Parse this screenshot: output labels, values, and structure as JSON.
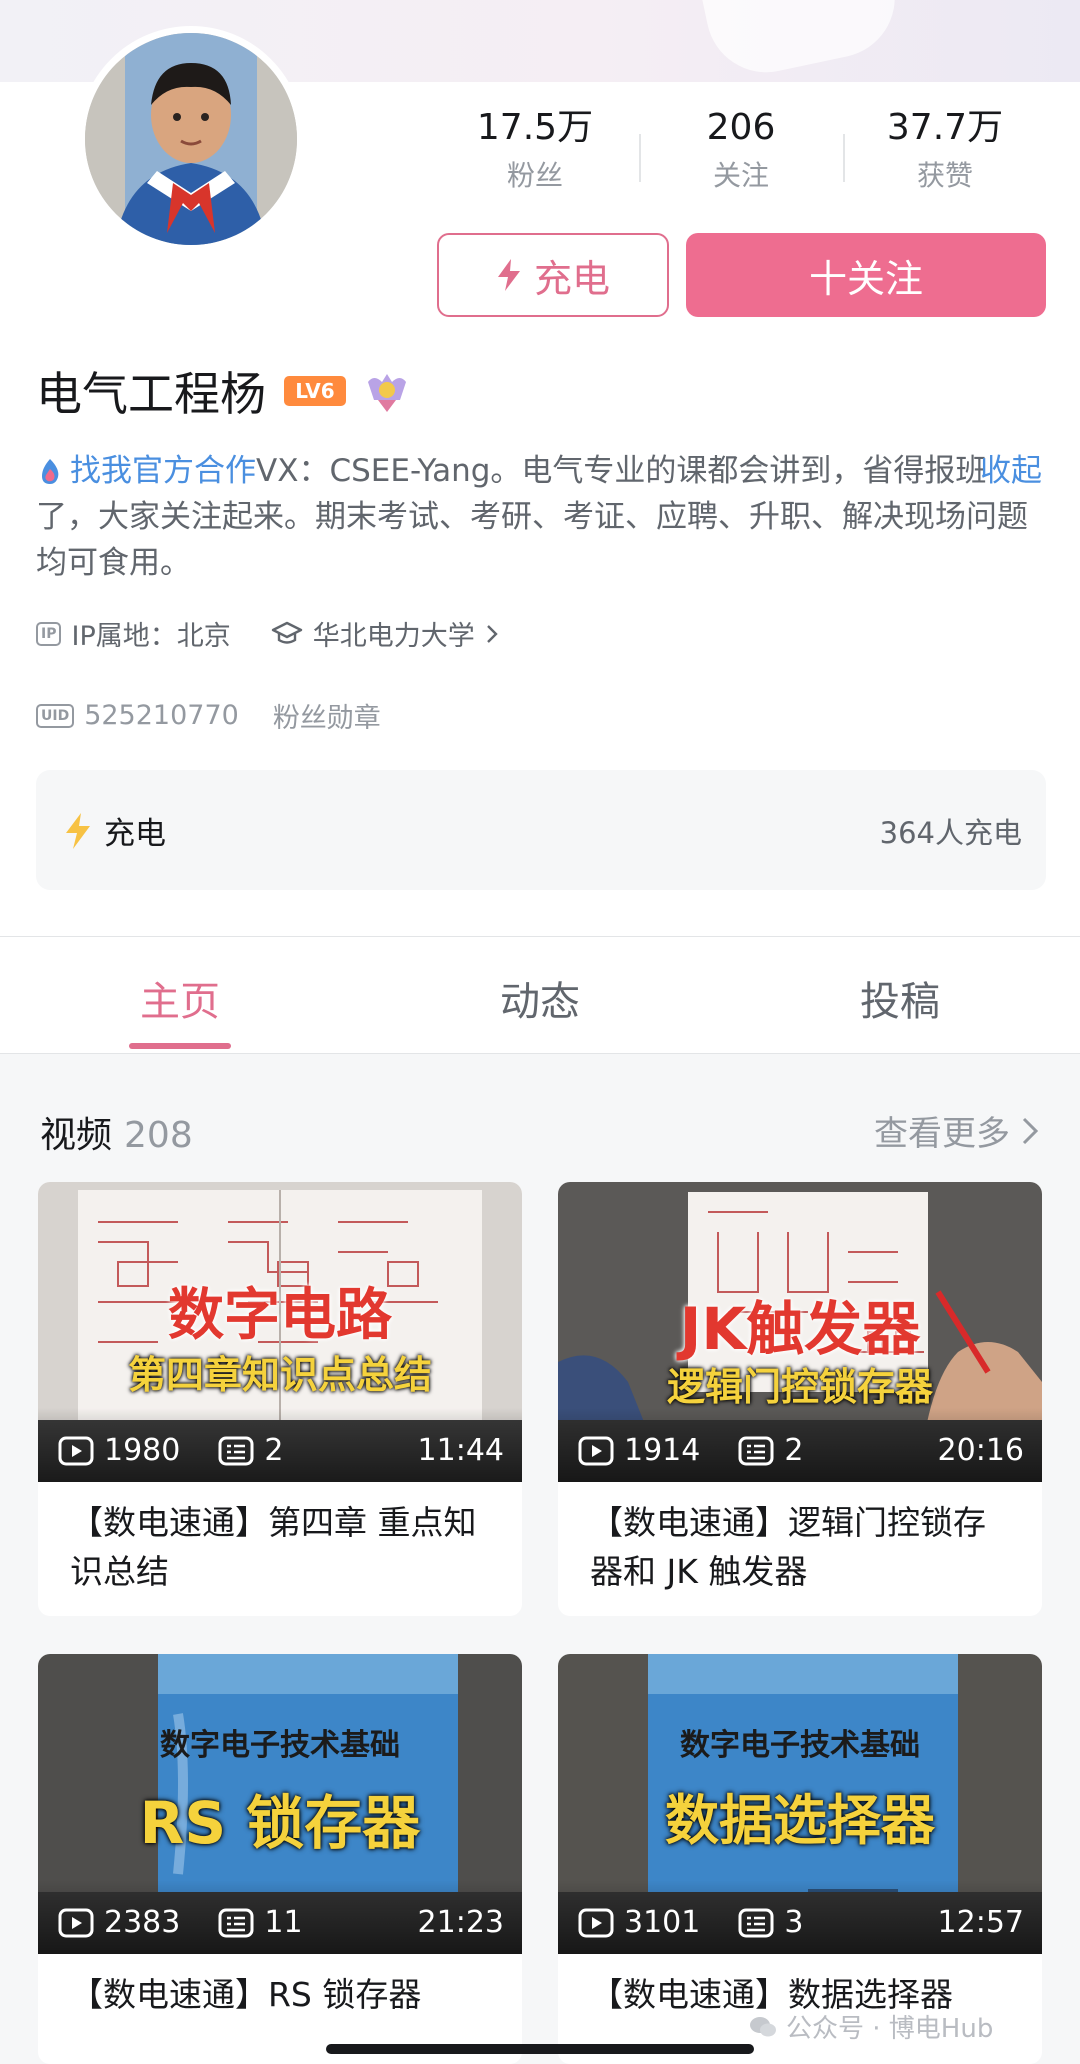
{
  "profile": {
    "name": "电气工程杨",
    "level_badge": "LV6",
    "stats": [
      {
        "value": "17.5万",
        "label": "粉丝"
      },
      {
        "value": "206",
        "label": "关注"
      },
      {
        "value": "37.7万",
        "label": "获赞"
      }
    ],
    "charge_button": "充电",
    "follow_button": "十关注",
    "bio_link": "找我官方合作",
    "bio_text": "VX：CSEE-Yang。电气专业的课都会讲到，省得报班了，大家关注起来。期末考试、考研、考证、应聘、升职、解决现场问题均可食用。",
    "bio_toggle": "收起",
    "ip_tag": "IP",
    "ip_location": "IP属地：北京",
    "school": "华北电力大学",
    "uid_tag": "UID",
    "uid": "525210770",
    "fan_badge": "粉丝勋章"
  },
  "charge_card": {
    "label": "充电",
    "count_text": "364人充电"
  },
  "tabs": [
    "主页",
    "动态",
    "投稿"
  ],
  "videos_section": {
    "title": "视频",
    "count": "208",
    "more": "查看更多"
  },
  "videos": [
    {
      "thumb_main": "数字电路",
      "thumb_sub": "第四章知识点总结",
      "views": "1980",
      "danmaku": "2",
      "duration": "11:44",
      "title": "【数电速通】第四章 重点知识总结"
    },
    {
      "thumb_main": "JK触发器",
      "thumb_sub": "逻辑门控锁存器",
      "views": "1914",
      "danmaku": "2",
      "duration": "20:16",
      "title": "【数电速通】逻辑门控锁存器和 JK 触发器"
    },
    {
      "thumb_book": "数字电子技术基础",
      "thumb_main": "RS  锁存器",
      "views": "2383",
      "danmaku": "11",
      "duration": "21:23",
      "title": "【数电速通】RS 锁存器"
    },
    {
      "thumb_book": "数字电子技术基础",
      "thumb_main": "数据选择器",
      "views": "3101",
      "danmaku": "3",
      "duration": "12:57",
      "title": "【数电速通】数据选择器"
    }
  ],
  "watermark": "公众号 · 博电Hub",
  "colors": {
    "accent": "#ee6d90",
    "link": "#4a8fe0",
    "level": "#ff8a3d"
  }
}
